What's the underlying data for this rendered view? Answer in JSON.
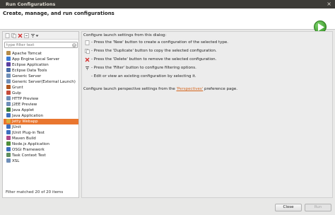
{
  "window": {
    "title": "Run Configurations"
  },
  "header": {
    "heading": "Create, manage, and run configurations"
  },
  "filter": {
    "placeholder": "type filter text"
  },
  "tree": {
    "items": [
      {
        "label": "Apache Tomcat",
        "color": "#b58c4a"
      },
      {
        "label": "App Engine Local Server",
        "color": "#3a7bd5"
      },
      {
        "label": "Eclipse Application",
        "color": "#5b3fa0"
      },
      {
        "label": "Eclipse Data Tools",
        "color": "#4b6fa8"
      },
      {
        "label": "Generic Server",
        "color": "#6f8fb8"
      },
      {
        "label": "Generic Server(External Launch)",
        "color": "#6f8fb8"
      },
      {
        "label": "Grunt",
        "color": "#b0571f"
      },
      {
        "label": "Gulp",
        "color": "#c64b3b"
      },
      {
        "label": "HTTP Preview",
        "color": "#6f8fb8"
      },
      {
        "label": "J2EE Preview",
        "color": "#6f8fb8"
      },
      {
        "label": "Java Applet",
        "color": "#3d7e3d"
      },
      {
        "label": "Java Application",
        "color": "#3d6fbf"
      },
      {
        "label": "Jetty Webapp",
        "color": "#d9b03b"
      },
      {
        "label": "JUnit",
        "color": "#3d6fbf"
      },
      {
        "label": "JUnit Plug-in Test",
        "color": "#3d6fbf"
      },
      {
        "label": "Maven Build",
        "color": "#b04a8a"
      },
      {
        "label": "Node.js Application",
        "color": "#4f8f3b"
      },
      {
        "label": "OSGi Framework",
        "color": "#3d6fbf"
      },
      {
        "label": "Task Context Test",
        "color": "#5f8f5f"
      },
      {
        "label": "XSL",
        "color": "#6f8fb8"
      }
    ],
    "selected_index": 12,
    "count_text": "Filter matched 20 of 20 items"
  },
  "right": {
    "intro": "Configure launch settings from this dialog:",
    "bullets": [
      {
        "text": "- Press the 'New' button to create a configuration of the selected type.",
        "icon": "new-config-icon"
      },
      {
        "text": "- Press the 'Duplicate' button to copy the selected configuration.",
        "icon": "duplicate-icon"
      },
      {
        "text": "- Press the 'Delete' button to remove the selected configuration.",
        "icon": "delete-icon"
      },
      {
        "text": "- Press the 'Filter' button to configure filtering options.",
        "icon": "filter-icon"
      },
      {
        "text": "- Edit or view an existing configuration by selecting it.",
        "icon": ""
      }
    ],
    "perspectives_prefix": "Configure launch perspective settings from the ",
    "perspectives_link": "'Perspectives'",
    "perspectives_suffix": " preference page."
  },
  "buttons": {
    "close": "Close",
    "run": "Run"
  }
}
